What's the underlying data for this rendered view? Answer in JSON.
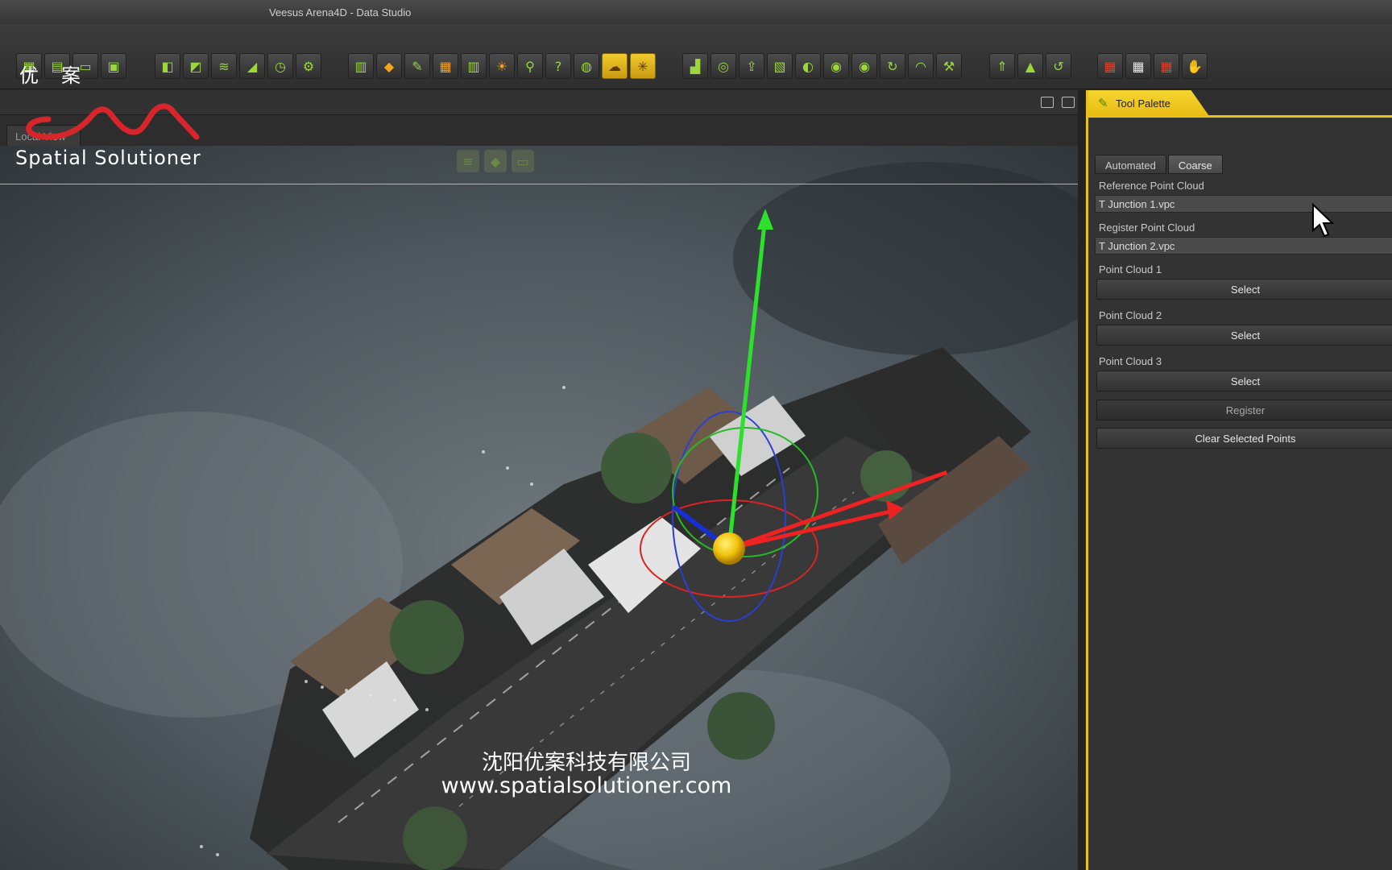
{
  "window": {
    "title": "Veesus Arena4D - Data Studio"
  },
  "toolbar": {
    "group1": [
      {
        "name": "project-icon",
        "glyph": "▦"
      },
      {
        "name": "layers-icon",
        "glyph": "▤"
      },
      {
        "name": "document-icon",
        "glyph": "▭"
      },
      {
        "name": "publish-icon",
        "glyph": "▣"
      }
    ],
    "group2": [
      {
        "name": "map-icon",
        "glyph": "◧"
      },
      {
        "name": "rss-icon",
        "glyph": "◩"
      },
      {
        "name": "stack-icon",
        "glyph": "≋"
      },
      {
        "name": "profile-icon",
        "glyph": "◢"
      },
      {
        "name": "clock-icon",
        "glyph": "◷"
      },
      {
        "name": "settings-icon",
        "glyph": "⚙"
      }
    ],
    "group3": [
      {
        "name": "chart-icon",
        "glyph": "▥"
      },
      {
        "name": "paint-icon",
        "glyph": "◆",
        "color": "orange"
      },
      {
        "name": "brush-icon",
        "glyph": "✎"
      },
      {
        "name": "grid-icon",
        "glyph": "▦",
        "color": "orange"
      },
      {
        "name": "sliders-icon",
        "glyph": "▥"
      },
      {
        "name": "sun-icon",
        "glyph": "☀",
        "color": "orange"
      },
      {
        "name": "zoom-icon",
        "glyph": "⚲"
      },
      {
        "name": "help-icon",
        "glyph": "?"
      },
      {
        "name": "globe-icon",
        "glyph": "◍"
      },
      {
        "name": "cloud-icon",
        "glyph": "☁",
        "color": "yellow"
      },
      {
        "name": "crosshair-icon",
        "glyph": "✳",
        "color": "yellow"
      }
    ],
    "group4": [
      {
        "name": "blocks-icon",
        "glyph": "▟"
      },
      {
        "name": "target-icon",
        "glyph": "◎"
      },
      {
        "name": "upload-icon",
        "glyph": "⇪"
      },
      {
        "name": "mesh-icon",
        "glyph": "▧"
      },
      {
        "name": "compass-icon",
        "glyph": "◐"
      },
      {
        "name": "sphere-icon",
        "glyph": "◉"
      },
      {
        "name": "eye-icon",
        "glyph": "◉"
      },
      {
        "name": "refresh-icon",
        "glyph": "↻"
      },
      {
        "name": "headset-icon",
        "glyph": "◠"
      },
      {
        "name": "tools-icon",
        "glyph": "⚒"
      }
    ],
    "group5": [
      {
        "name": "up-arrow-icon",
        "glyph": "⇑"
      },
      {
        "name": "up-icon",
        "glyph": "▲"
      },
      {
        "name": "undo-icon",
        "glyph": "↺"
      }
    ],
    "group6": [
      {
        "name": "grid-red-icon",
        "glyph": "▦",
        "color": "red"
      },
      {
        "name": "grid-white-icon",
        "glyph": "▦",
        "color": "white"
      },
      {
        "name": "grid-select-icon",
        "glyph": "▦",
        "color": "red"
      },
      {
        "name": "hand-icon",
        "glyph": "✋",
        "color": "white"
      }
    ]
  },
  "logo": {
    "cn": "优案",
    "text": "Spatial Solutioner"
  },
  "view": {
    "tab_label": "Local View"
  },
  "panel": {
    "tab_label": "Tool Palette",
    "subtabs": [
      "Automated",
      "Coarse"
    ],
    "reference_label": "Reference Point Cloud",
    "reference_value": "T Junction 1.vpc",
    "register_label": "Register Point Cloud",
    "register_value": "T Junction 2.vpc",
    "pc1_label": "Point Cloud 1",
    "pc2_label": "Point Cloud 2",
    "pc3_label": "Point Cloud 3",
    "select_label": "Select",
    "register_button": "Register",
    "clear_button": "Clear Selected Points"
  },
  "watermark": {
    "company": "沈阳优案科技有限公司",
    "url": "www.spatialsolutioner.com"
  },
  "colors": {
    "accent": "#e6c21b",
    "icon_green": "#9bd63a",
    "logo_red": "#d8252b"
  }
}
